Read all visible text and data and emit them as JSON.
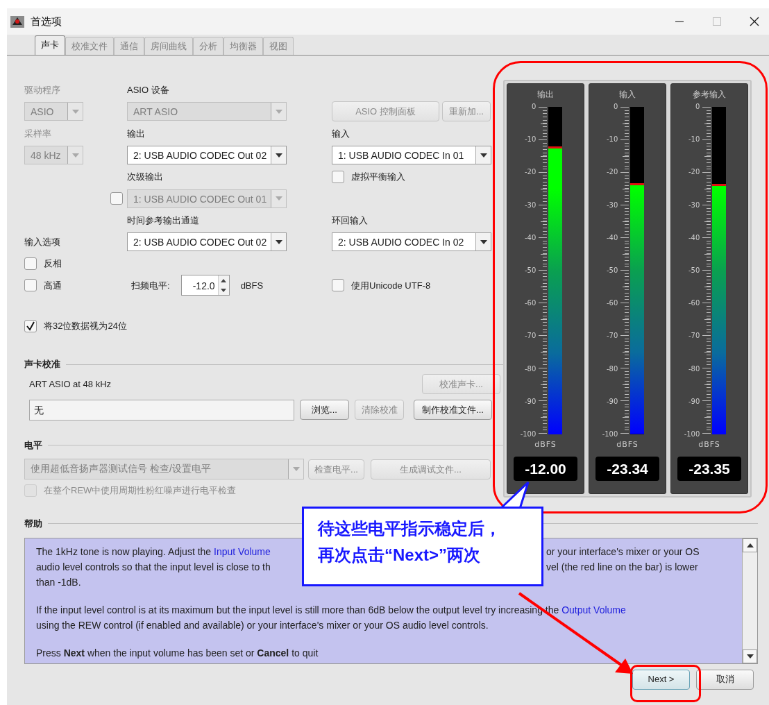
{
  "window": {
    "title": "首选项"
  },
  "tabs": [
    {
      "label": "声卡",
      "selected": true
    },
    {
      "label": "校准文件",
      "selected": false
    },
    {
      "label": "通信",
      "selected": false
    },
    {
      "label": "房间曲线",
      "selected": false
    },
    {
      "label": "分析",
      "selected": false
    },
    {
      "label": "均衡器",
      "selected": false
    },
    {
      "label": "视图",
      "selected": false
    }
  ],
  "device": {
    "driver": {
      "label": "驱动程序",
      "value": "ASIO",
      "disabled": true
    },
    "asio_device": {
      "label": "ASIO 设备",
      "value": "ART ASIO",
      "disabled": true
    },
    "asio_buttons": [
      {
        "label": "ASIO 控制面板",
        "disabled": true
      },
      {
        "label": "重新加...",
        "disabled": true
      }
    ],
    "sample_rate": {
      "label": "采样率",
      "value": "48 kHz",
      "disabled": true
    },
    "output": {
      "label": "输出",
      "value": "2: USB AUDIO  CODEC Out 02",
      "disabled": false
    },
    "input": {
      "label": "输入",
      "value": "1: USB AUDIO  CODEC In 01",
      "disabled": false
    },
    "virtual_balanced": {
      "label": "虚拟平衡输入",
      "checked": false
    },
    "secondary_output": {
      "label": "次级输出",
      "value": "1: USB AUDIO  CODEC Out 01",
      "disabled": true,
      "checked": false
    },
    "timing_ref_output": {
      "label": "时间参考输出通道",
      "value": "2: USB AUDIO  CODEC Out 02",
      "disabled": false
    },
    "loopback_input": {
      "label": "环回输入",
      "value": "2: USB AUDIO  CODEC In 02",
      "disabled": false
    },
    "input_options": {
      "label": "输入选项",
      "checks": [
        {
          "label": "反相",
          "checked": false
        },
        {
          "label": "高通",
          "checked": false
        }
      ]
    },
    "sweep_level": {
      "label": "扫频电平:",
      "value": "-12.0",
      "unit": "dBFS"
    },
    "unicode": {
      "label": "使用Unicode UTF-8",
      "checked": false
    },
    "treat_32": {
      "label": "将32位数据视为24位",
      "checked": true
    }
  },
  "calibration": {
    "heading": "声卡校准",
    "device_text": "ART ASIO at 48 kHz",
    "calibrate_button": {
      "label": "校准声卡...",
      "disabled": true
    },
    "file": "无",
    "buttons": [
      {
        "label": "浏览...",
        "disabled": false
      },
      {
        "label": "清除校准",
        "disabled": true
      },
      {
        "label": "制作校准文件...",
        "disabled": false
      }
    ]
  },
  "levels": {
    "heading": "电平",
    "signal": {
      "value": "使用超低音扬声器测试信号 检查/设置电平",
      "disabled": true
    },
    "buttons": [
      {
        "label": "检查电平...",
        "disabled": true
      },
      {
        "label": "生成调试文件...",
        "disabled": true
      }
    ],
    "periodic_check": {
      "label": "在整个REW中使用周期性粉红噪声进行电平检查",
      "checked": false,
      "disabled": true
    }
  },
  "meters": [
    {
      "name": "输出",
      "level": 0.88,
      "scale": [
        "0",
        "-10",
        "-20",
        "-30",
        "-40",
        "-50",
        "-60",
        "-70",
        "-80",
        "-90",
        "-100"
      ],
      "unit": "dBFS",
      "reading": "-12.00"
    },
    {
      "name": "输入",
      "level": 0.766,
      "scale": [
        "0",
        "-10",
        "-20",
        "-30",
        "-40",
        "-50",
        "-60",
        "-70",
        "-80",
        "-90",
        "-100"
      ],
      "unit": "dBFS",
      "reading": "-23.34"
    },
    {
      "name": "参考输入",
      "level": 0.765,
      "scale": [
        "0",
        "-10",
        "-20",
        "-30",
        "-40",
        "-50",
        "-60",
        "-70",
        "-80",
        "-90",
        "-100"
      ],
      "unit": "dBFS",
      "reading": "-23.35"
    }
  ],
  "help": {
    "heading": "帮助",
    "paragraphs": [
      [
        {
          "left": [
            {
              "kind": "plain",
              "text": "The 1kHz tone is now playing. Adjust the "
            },
            {
              "kind": "link",
              "text": "Input Volume"
            }
          ],
          "right": [
            {
              "kind": "plain",
              "text": "or your interface's mixer or your OS"
            }
          ]
        },
        {
          "left": [
            {
              "kind": "plain",
              "text": "audio level controls so that the input level is close to th"
            }
          ],
          "right": [
            {
              "kind": "plain",
              "text": "vel (the red line on the bar) is lower"
            }
          ]
        },
        {
          "left": [
            {
              "kind": "plain",
              "text": "than -1dB."
            }
          ]
        }
      ],
      [
        {
          "left": [
            {
              "kind": "plain",
              "text": "If the input level control is at its maximum but the input level is still more than 6dB below the output level try increasing the "
            },
            {
              "kind": "link",
              "text": "Output Volume"
            }
          ]
        },
        {
          "left": [
            {
              "kind": "plain",
              "text": "using the REW control (if enabled and available) or your interface's mixer or your OS audio level controls."
            }
          ]
        }
      ],
      [
        {
          "left": [
            {
              "kind": "plain",
              "text": "Press **Next** when the input volume has been set or **Cancel** to quit"
            }
          ]
        }
      ]
    ]
  },
  "callout": {
    "lines": [
      "待这些电平指示稳定后，",
      "再次点击“Next>”两次"
    ]
  },
  "buttons": [
    {
      "label": "Next >",
      "focused": true
    },
    {
      "label": "取消",
      "focused": false
    }
  ]
}
